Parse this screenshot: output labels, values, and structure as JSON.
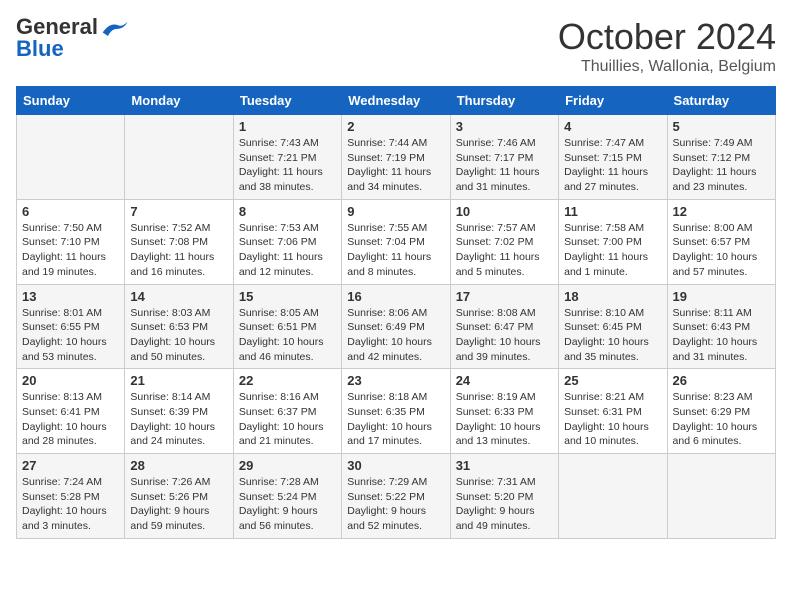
{
  "header": {
    "logo_line1": "General",
    "logo_line2": "Blue",
    "month_title": "October 2024",
    "subtitle": "Thuillies, Wallonia, Belgium"
  },
  "days_of_week": [
    "Sunday",
    "Monday",
    "Tuesday",
    "Wednesday",
    "Thursday",
    "Friday",
    "Saturday"
  ],
  "weeks": [
    [
      {
        "day": "",
        "content": ""
      },
      {
        "day": "",
        "content": ""
      },
      {
        "day": "1",
        "content": "Sunrise: 7:43 AM\nSunset: 7:21 PM\nDaylight: 11 hours and 38 minutes."
      },
      {
        "day": "2",
        "content": "Sunrise: 7:44 AM\nSunset: 7:19 PM\nDaylight: 11 hours and 34 minutes."
      },
      {
        "day": "3",
        "content": "Sunrise: 7:46 AM\nSunset: 7:17 PM\nDaylight: 11 hours and 31 minutes."
      },
      {
        "day": "4",
        "content": "Sunrise: 7:47 AM\nSunset: 7:15 PM\nDaylight: 11 hours and 27 minutes."
      },
      {
        "day": "5",
        "content": "Sunrise: 7:49 AM\nSunset: 7:12 PM\nDaylight: 11 hours and 23 minutes."
      }
    ],
    [
      {
        "day": "6",
        "content": "Sunrise: 7:50 AM\nSunset: 7:10 PM\nDaylight: 11 hours and 19 minutes."
      },
      {
        "day": "7",
        "content": "Sunrise: 7:52 AM\nSunset: 7:08 PM\nDaylight: 11 hours and 16 minutes."
      },
      {
        "day": "8",
        "content": "Sunrise: 7:53 AM\nSunset: 7:06 PM\nDaylight: 11 hours and 12 minutes."
      },
      {
        "day": "9",
        "content": "Sunrise: 7:55 AM\nSunset: 7:04 PM\nDaylight: 11 hours and 8 minutes."
      },
      {
        "day": "10",
        "content": "Sunrise: 7:57 AM\nSunset: 7:02 PM\nDaylight: 11 hours and 5 minutes."
      },
      {
        "day": "11",
        "content": "Sunrise: 7:58 AM\nSunset: 7:00 PM\nDaylight: 11 hours and 1 minute."
      },
      {
        "day": "12",
        "content": "Sunrise: 8:00 AM\nSunset: 6:57 PM\nDaylight: 10 hours and 57 minutes."
      }
    ],
    [
      {
        "day": "13",
        "content": "Sunrise: 8:01 AM\nSunset: 6:55 PM\nDaylight: 10 hours and 53 minutes."
      },
      {
        "day": "14",
        "content": "Sunrise: 8:03 AM\nSunset: 6:53 PM\nDaylight: 10 hours and 50 minutes."
      },
      {
        "day": "15",
        "content": "Sunrise: 8:05 AM\nSunset: 6:51 PM\nDaylight: 10 hours and 46 minutes."
      },
      {
        "day": "16",
        "content": "Sunrise: 8:06 AM\nSunset: 6:49 PM\nDaylight: 10 hours and 42 minutes."
      },
      {
        "day": "17",
        "content": "Sunrise: 8:08 AM\nSunset: 6:47 PM\nDaylight: 10 hours and 39 minutes."
      },
      {
        "day": "18",
        "content": "Sunrise: 8:10 AM\nSunset: 6:45 PM\nDaylight: 10 hours and 35 minutes."
      },
      {
        "day": "19",
        "content": "Sunrise: 8:11 AM\nSunset: 6:43 PM\nDaylight: 10 hours and 31 minutes."
      }
    ],
    [
      {
        "day": "20",
        "content": "Sunrise: 8:13 AM\nSunset: 6:41 PM\nDaylight: 10 hours and 28 minutes."
      },
      {
        "day": "21",
        "content": "Sunrise: 8:14 AM\nSunset: 6:39 PM\nDaylight: 10 hours and 24 minutes."
      },
      {
        "day": "22",
        "content": "Sunrise: 8:16 AM\nSunset: 6:37 PM\nDaylight: 10 hours and 21 minutes."
      },
      {
        "day": "23",
        "content": "Sunrise: 8:18 AM\nSunset: 6:35 PM\nDaylight: 10 hours and 17 minutes."
      },
      {
        "day": "24",
        "content": "Sunrise: 8:19 AM\nSunset: 6:33 PM\nDaylight: 10 hours and 13 minutes."
      },
      {
        "day": "25",
        "content": "Sunrise: 8:21 AM\nSunset: 6:31 PM\nDaylight: 10 hours and 10 minutes."
      },
      {
        "day": "26",
        "content": "Sunrise: 8:23 AM\nSunset: 6:29 PM\nDaylight: 10 hours and 6 minutes."
      }
    ],
    [
      {
        "day": "27",
        "content": "Sunrise: 7:24 AM\nSunset: 5:28 PM\nDaylight: 10 hours and 3 minutes."
      },
      {
        "day": "28",
        "content": "Sunrise: 7:26 AM\nSunset: 5:26 PM\nDaylight: 9 hours and 59 minutes."
      },
      {
        "day": "29",
        "content": "Sunrise: 7:28 AM\nSunset: 5:24 PM\nDaylight: 9 hours and 56 minutes."
      },
      {
        "day": "30",
        "content": "Sunrise: 7:29 AM\nSunset: 5:22 PM\nDaylight: 9 hours and 52 minutes."
      },
      {
        "day": "31",
        "content": "Sunrise: 7:31 AM\nSunset: 5:20 PM\nDaylight: 9 hours and 49 minutes."
      },
      {
        "day": "",
        "content": ""
      },
      {
        "day": "",
        "content": ""
      }
    ]
  ]
}
